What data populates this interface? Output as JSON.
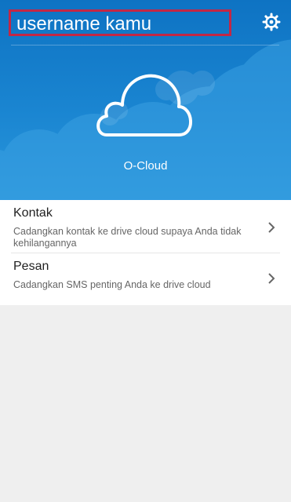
{
  "header": {
    "username": "username kamu",
    "app_name": "O-Cloud",
    "highlight_color": "#c32745",
    "icons": {
      "settings": "gear-icon",
      "cloud": "cloud-icon"
    }
  },
  "list": {
    "items": [
      {
        "title": "Kontak",
        "description": "Cadangkan kontak ke drive cloud supaya Anda tidak kehilangannya",
        "icon": "chevron-right-icon"
      },
      {
        "title": "Pesan",
        "description": "Cadangkan SMS penting Anda ke drive cloud",
        "icon": "chevron-right-icon"
      }
    ]
  }
}
